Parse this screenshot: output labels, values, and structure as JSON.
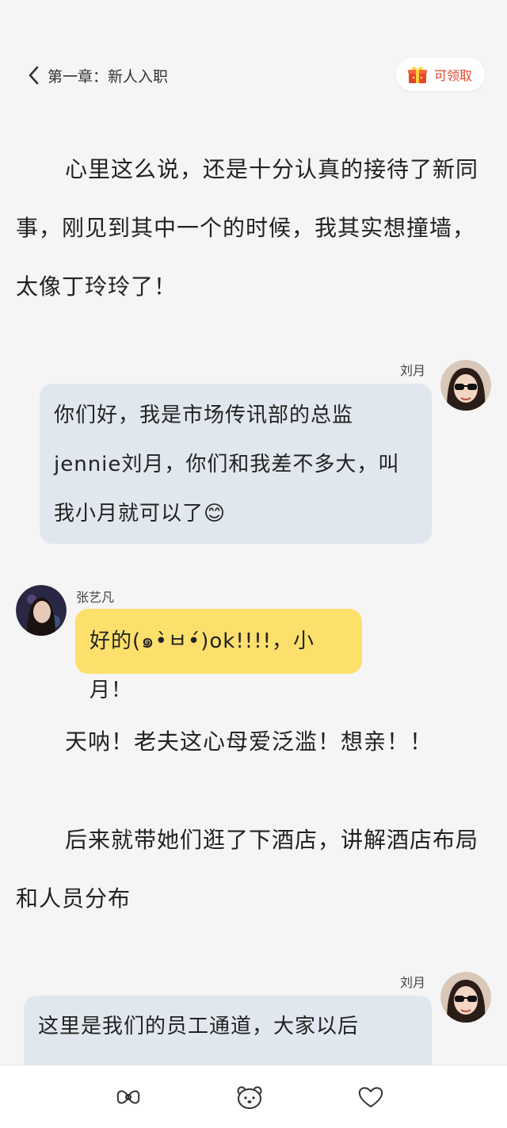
{
  "header": {
    "chapter_title": "第一章：新人入职",
    "claim_label": "可领取"
  },
  "story": {
    "para1": "心里这么说，还是十分认真的接待了新同事，刚见到其中一个的时候，我其实想撞墙，太像丁玲玲了！",
    "para2": "天呐！老夫这心母爱泛滥！想亲！！",
    "para3": "后来就带她们逛了下酒店，讲解酒店布局和人员分布"
  },
  "messages": [
    {
      "speaker": "刘月",
      "text": "你们好，我是市场传讯部的总监jennie刘月，你们和我差不多大，叫我小月就可以了😊"
    },
    {
      "speaker": "张艺凡",
      "text": "好的(๑•̀ㅂ•́)ok!!!!，小月！"
    },
    {
      "speaker": "刘月",
      "text": "这里是我们的员工通道，大家以后"
    }
  ],
  "bottom_bar": {
    "icons": [
      "bow-icon",
      "bear-face-icon",
      "heart-icon"
    ]
  }
}
